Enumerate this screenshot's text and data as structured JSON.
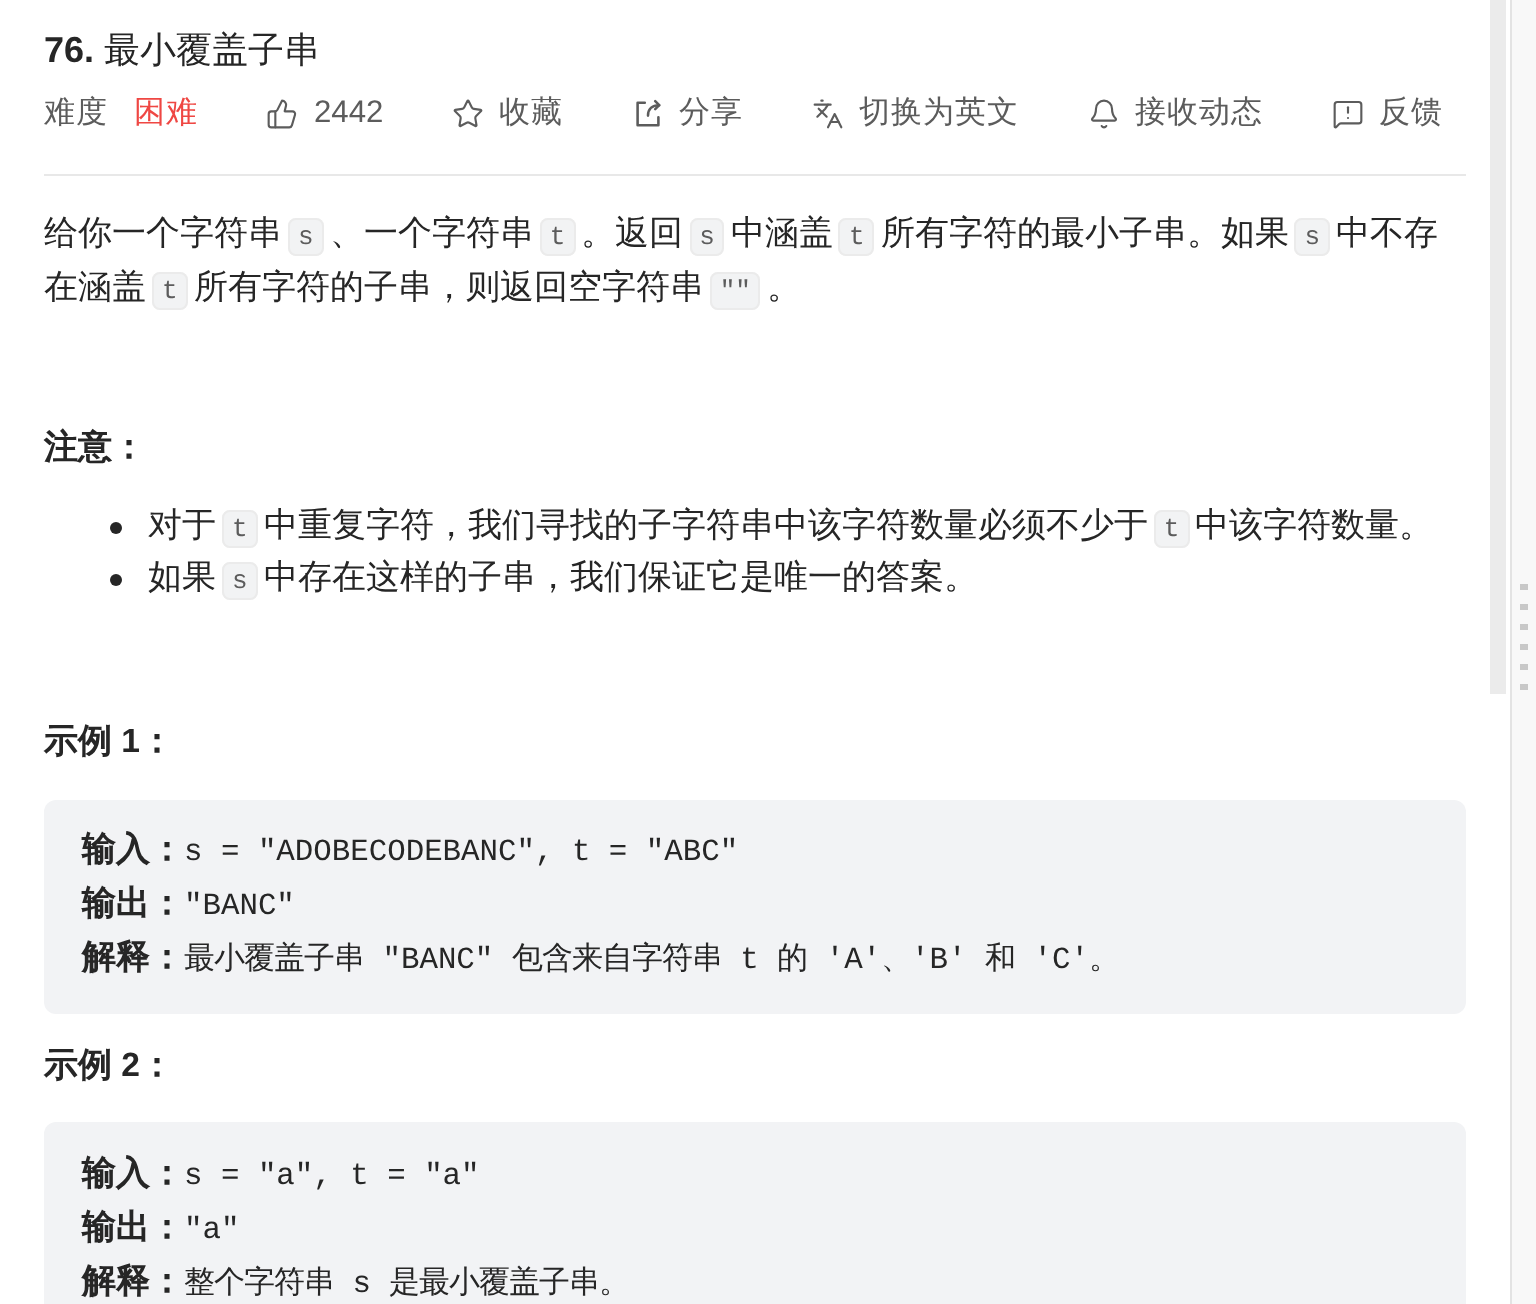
{
  "title": "**76.** 最小覆盖子串",
  "meta": {
    "difficulty_label": "难度",
    "difficulty": {
      "text": "困难",
      "kind": "hard"
    },
    "actions": [
      {
        "kind": "like",
        "label": "2442"
      },
      {
        "kind": "favorite",
        "label": "收藏"
      },
      {
        "kind": "share",
        "label": "分享"
      },
      {
        "kind": "translate",
        "label": "切换为英文"
      },
      {
        "kind": "subscribe",
        "label": "接收动态"
      },
      {
        "kind": "feedback",
        "label": "反馈"
      }
    ]
  },
  "description": [
    {
      "kind": "text",
      "text": "给你一个字符串"
    },
    {
      "kind": "code",
      "text": "s"
    },
    {
      "kind": "text",
      "text": "、一个字符串"
    },
    {
      "kind": "code",
      "text": "t"
    },
    {
      "kind": "text",
      "text": "。返回"
    },
    {
      "kind": "code",
      "text": "s"
    },
    {
      "kind": "text",
      "text": "中涵盖"
    },
    {
      "kind": "code",
      "text": "t"
    },
    {
      "kind": "text",
      "text": "所有字符的最小子串。如果"
    },
    {
      "kind": "code",
      "text": "s"
    },
    {
      "kind": "text",
      "text": "中不存在涵盖"
    },
    {
      "kind": "code",
      "text": "t"
    },
    {
      "kind": "text",
      "text": "所有字符的子串，则返回空字符串"
    },
    {
      "kind": "code",
      "text": "\"\""
    },
    {
      "kind": "text",
      "text": "。"
    }
  ],
  "note": {
    "heading": "注意：",
    "items": [
      [
        {
          "kind": "text",
          "text": "对于"
        },
        {
          "kind": "code",
          "text": "t"
        },
        {
          "kind": "text",
          "text": "中重复字符，我们寻找的子字符串中该字符数量必须不少于"
        },
        {
          "kind": "code",
          "text": "t"
        },
        {
          "kind": "text",
          "text": "中该字符数量。"
        }
      ],
      [
        {
          "kind": "text",
          "text": "如果"
        },
        {
          "kind": "code",
          "text": "s"
        },
        {
          "kind": "text",
          "text": "中存在这样的子串，我们保证它是唯一的答案。"
        }
      ]
    ]
  },
  "examples": [
    {
      "heading": "示例 1：",
      "lines": [
        {
          "label": "输入：",
          "text": "s = \"ADOBECODEBANC\", t = \"ABC\""
        },
        {
          "label": "输出：",
          "text": "\"BANC\""
        },
        {
          "label": "解释：",
          "text": "最小覆盖子串 \"BANC\" 包含来自字符串 t 的 'A'、'B' 和 'C'。"
        }
      ]
    },
    {
      "heading": "示例 2：",
      "lines": [
        {
          "label": "输入：",
          "text": "s = \"a\", t = \"a\""
        },
        {
          "label": "输出：",
          "text": "\"a\""
        },
        {
          "label": "解释：",
          "text": "整个字符串 s 是最小覆盖子串。"
        }
      ]
    }
  ]
}
